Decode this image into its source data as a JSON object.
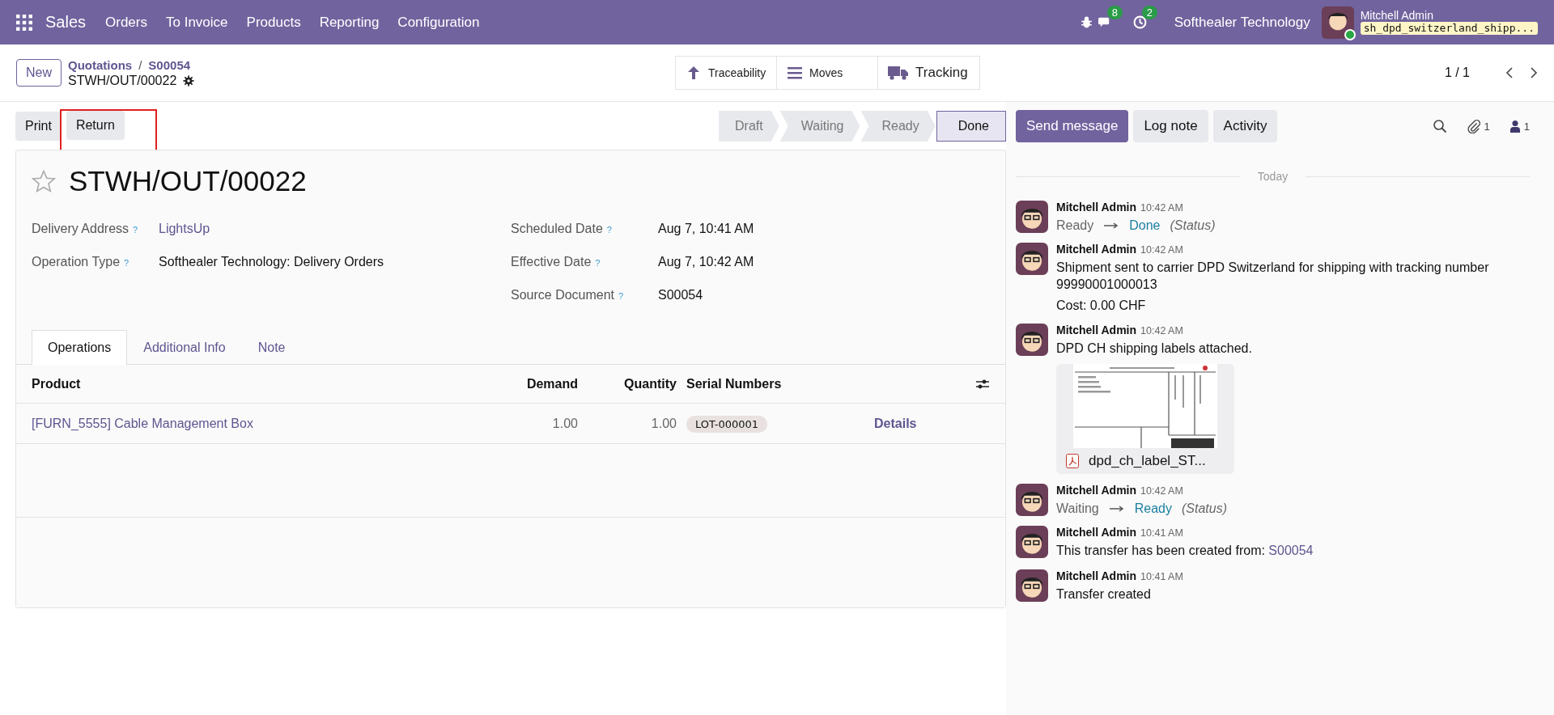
{
  "navbar": {
    "app": "Sales",
    "menu": [
      "Orders",
      "To Invoice",
      "Products",
      "Reporting",
      "Configuration"
    ],
    "messages_count": "8",
    "activities_count": "2",
    "company": "Softhealer Technology",
    "user": "Mitchell Admin",
    "database": "sh_dpd_switzerland_shipp..."
  },
  "control_panel": {
    "new_button": "New",
    "breadcrumbs": [
      "Quotations",
      "S00054"
    ],
    "separator": "/",
    "record": "STWH/OUT/00022",
    "smart_buttons": [
      {
        "kind": "arrow",
        "label": "Traceability"
      },
      {
        "kind": "list",
        "label": "Moves"
      },
      {
        "kind": "truck",
        "label": "Tracking"
      }
    ],
    "pager": "1 / 1"
  },
  "actions": [
    {
      "label": "Print",
      "highlighted": false
    },
    {
      "label": "Return",
      "highlighted": true
    }
  ],
  "statusbar": [
    {
      "label": "Draft",
      "selected": false
    },
    {
      "label": "Waiting",
      "selected": false
    },
    {
      "label": "Ready",
      "selected": false
    },
    {
      "label": "Done",
      "selected": true
    }
  ],
  "form": {
    "title": "STWH/OUT/00022",
    "starred": false,
    "left_fields": [
      {
        "label": "Delivery Address",
        "value": "LightsUp",
        "kind": "link"
      },
      {
        "label": "Operation Type",
        "value": "Softhealer Technology: Delivery Orders",
        "kind": "text"
      }
    ],
    "right_fields": [
      {
        "label": "Scheduled Date",
        "value": "Aug 7, 10:41 AM"
      },
      {
        "label": "Effective Date",
        "value": "Aug 7, 10:42 AM"
      },
      {
        "label": "Source Document",
        "value": "S00054"
      }
    ],
    "help_mark": "?",
    "tabs": [
      {
        "label": "Operations",
        "selected": true
      },
      {
        "label": "Additional Info",
        "selected": false
      },
      {
        "label": "Note",
        "selected": false
      }
    ],
    "table": {
      "columns": [
        "Product",
        "Demand",
        "Quantity",
        "Serial Numbers"
      ],
      "rows": [
        {
          "product": "[FURN_5555] Cable Management Box",
          "demand": "1.00",
          "quantity": "1.00",
          "serial": "LOT-000001",
          "action": "Details"
        }
      ]
    }
  },
  "chatter": {
    "buttons": [
      {
        "label": "Send message",
        "selected": true
      },
      {
        "label": "Log note",
        "selected": false
      },
      {
        "label": "Activity",
        "selected": false
      }
    ],
    "attachments_count": "1",
    "followers_count": "1",
    "divider": "Today",
    "messages": [
      {
        "author": "Mitchell Admin",
        "time": "10:42 AM",
        "kind": "tracking",
        "from": "Ready",
        "to": "Done",
        "field": "(Status)"
      },
      {
        "author": "Mitchell Admin",
        "time": "10:42 AM",
        "kind": "text",
        "lines": [
          "Shipment sent to carrier DPD Switzerland for shipping with tracking number 99990001000013",
          "Cost: 0.00 CHF"
        ]
      },
      {
        "author": "Mitchell Admin",
        "time": "10:42 AM",
        "kind": "attachment",
        "lines": [
          "DPD CH shipping labels attached."
        ],
        "file": "dpd_ch_label_ST..."
      },
      {
        "author": "Mitchell Admin",
        "time": "10:42 AM",
        "kind": "tracking",
        "from": "Waiting",
        "to": "Ready",
        "field": "(Status)"
      },
      {
        "author": "Mitchell Admin",
        "time": "10:41 AM",
        "kind": "link",
        "text": "This transfer has been created from:",
        "link": "S00054"
      },
      {
        "author": "Mitchell Admin",
        "time": "10:41 AM",
        "kind": "text",
        "lines": [
          "Transfer created"
        ]
      }
    ]
  }
}
